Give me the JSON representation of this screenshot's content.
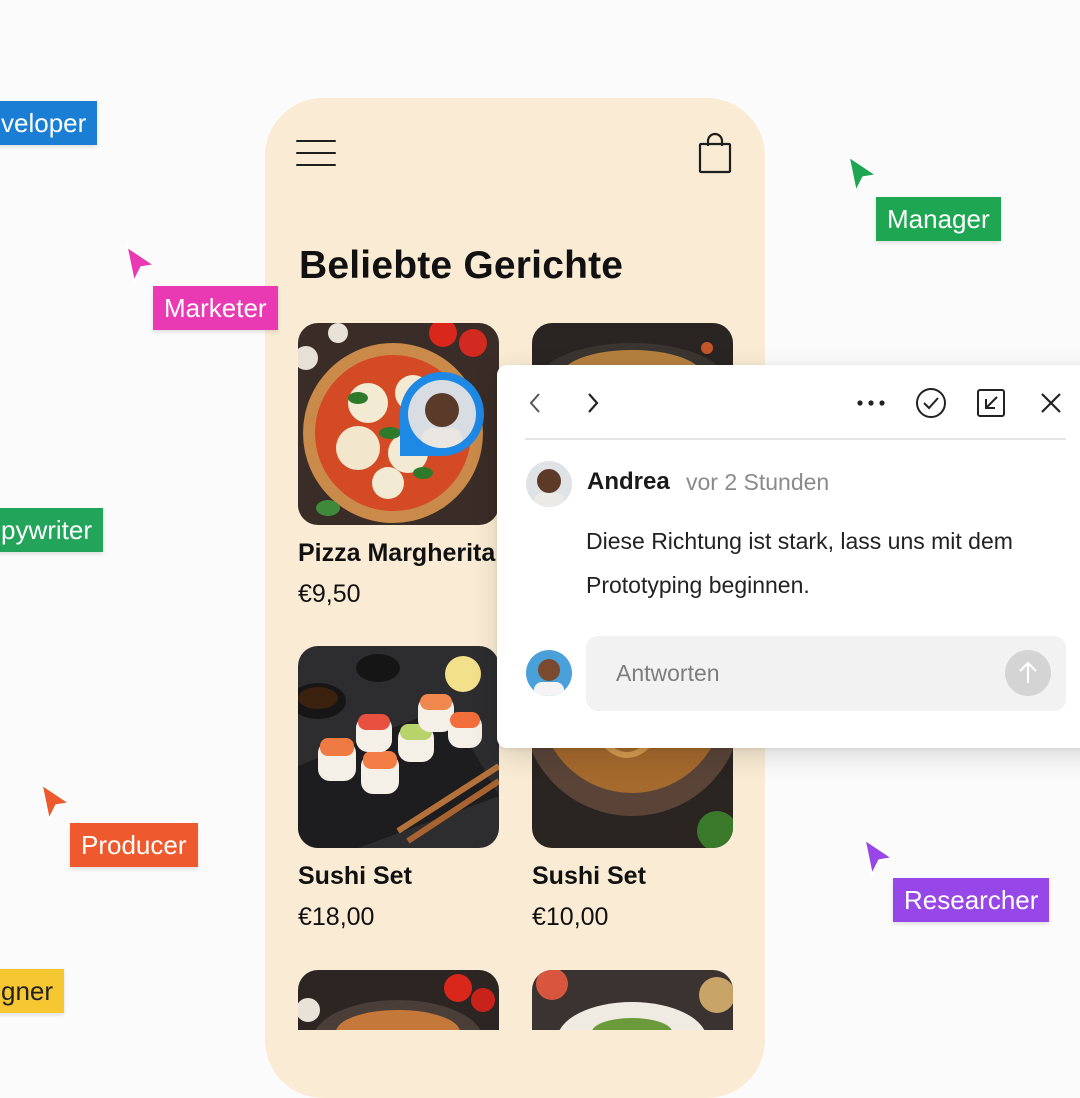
{
  "app": {
    "title": "Beliebte Gerichte",
    "accent_color": "#faecd4",
    "icons": [
      "hamburger-menu-icon",
      "shopping-bag-icon"
    ]
  },
  "dishes": [
    {
      "name": "Pizza Margherita",
      "price": "€9,50",
      "image": "pizza-photo"
    },
    {
      "name": "",
      "price": "",
      "image": "noodles-photo"
    },
    {
      "name": "Sushi Set",
      "price": "€18,00",
      "image": "sushi-photo"
    },
    {
      "name": "Sushi Set",
      "price": "€10,00",
      "image": "noodles-bowl-photo"
    },
    {
      "name": "",
      "price": "",
      "image": "pasta-photo"
    },
    {
      "name": "",
      "price": "",
      "image": "salad-photo"
    }
  ],
  "comment": {
    "author": "Andrea",
    "time": "vor 2 Stunden",
    "text": "Diese Richtung ist stark, lass uns mit dem Prototyping beginnen.",
    "reply_placeholder": "Antworten",
    "toolbar": [
      "chevron-left-icon",
      "chevron-right-icon",
      "more-icon",
      "resolve-check-icon",
      "open-external-icon",
      "close-icon"
    ]
  },
  "collaborators": [
    {
      "label": "Developer",
      "visible_text": "veloper",
      "color": "#1a7fd4"
    },
    {
      "label": "Marketer",
      "visible_text": "Marketer",
      "color": "#e93ab3"
    },
    {
      "label": "Manager",
      "visible_text": "Manager",
      "color": "#1fa652"
    },
    {
      "label": "Copywriter",
      "visible_text": "pywriter",
      "color": "#22a45a"
    },
    {
      "label": "Producer",
      "visible_text": "Producer",
      "color": "#ee5a2d"
    },
    {
      "label": "Researcher",
      "visible_text": "Researcher",
      "color": "#9747e8"
    },
    {
      "label": "Designer",
      "visible_text": "gner",
      "color": "#f7c732"
    }
  ]
}
